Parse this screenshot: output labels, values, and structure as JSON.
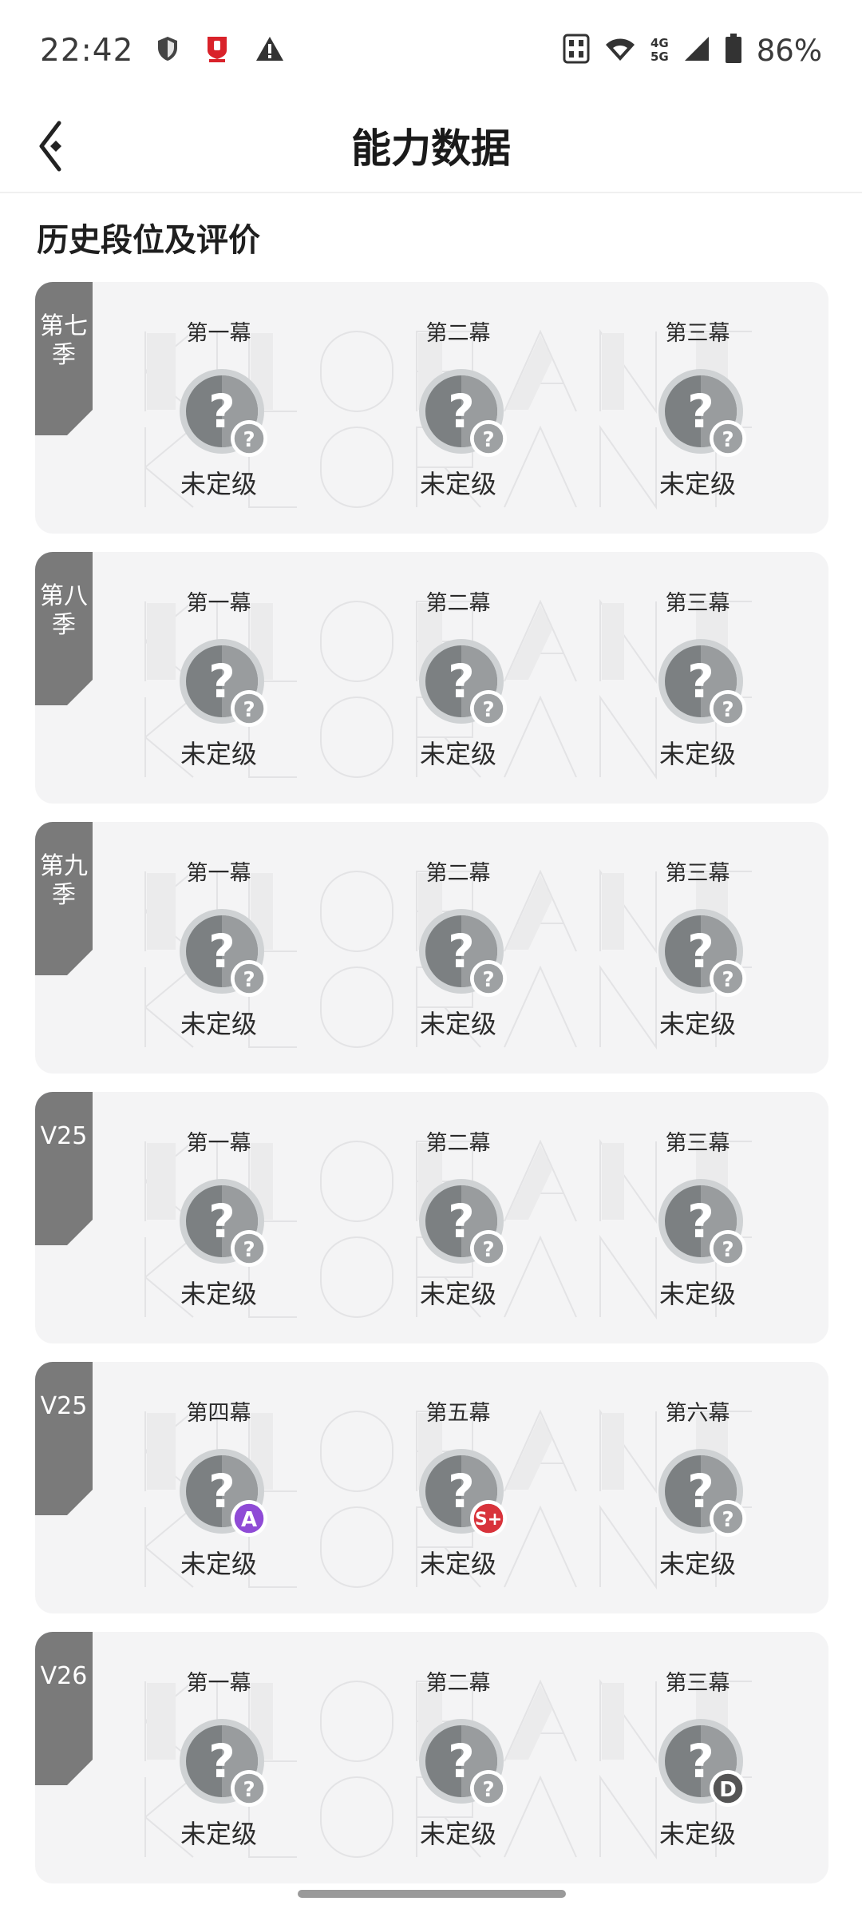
{
  "status_bar": {
    "time": "22:42",
    "battery": "86%",
    "net_top": "4G",
    "net_bottom": "5G",
    "icons": [
      "shield-icon",
      "app-notification-icon",
      "warning-icon",
      "nfc-icon",
      "wifi-icon",
      "cellular-signal-icon",
      "battery-icon"
    ]
  },
  "header": {
    "title": "能力数据",
    "back_icon": "back-arrow-icon"
  },
  "section": {
    "title": "历史段位及评价"
  },
  "colors": {
    "tab_gray": "#7a7a7a",
    "card_bg": "#f4f4f5",
    "emblem_gray": "#7c8082",
    "badge_purple": "#8f4bd6",
    "badge_red": "#d8333b",
    "badge_dark": "#555555"
  },
  "seasons": [
    {
      "label": "第七季",
      "acts": [
        {
          "name": "第一幕",
          "status": "未定级",
          "badge": "?"
        },
        {
          "name": "第二幕",
          "status": "未定级",
          "badge": "?"
        },
        {
          "name": "第三幕",
          "status": "未定级",
          "badge": "?"
        }
      ]
    },
    {
      "label": "第八季",
      "acts": [
        {
          "name": "第一幕",
          "status": "未定级",
          "badge": "?"
        },
        {
          "name": "第二幕",
          "status": "未定级",
          "badge": "?"
        },
        {
          "name": "第三幕",
          "status": "未定级",
          "badge": "?"
        }
      ]
    },
    {
      "label": "第九季",
      "acts": [
        {
          "name": "第一幕",
          "status": "未定级",
          "badge": "?"
        },
        {
          "name": "第二幕",
          "status": "未定级",
          "badge": "?"
        },
        {
          "name": "第三幕",
          "status": "未定级",
          "badge": "?"
        }
      ]
    },
    {
      "label": "V25",
      "acts": [
        {
          "name": "第一幕",
          "status": "未定级",
          "badge": "?"
        },
        {
          "name": "第二幕",
          "status": "未定级",
          "badge": "?"
        },
        {
          "name": "第三幕",
          "status": "未定级",
          "badge": "?"
        }
      ]
    },
    {
      "label": "V25",
      "acts": [
        {
          "name": "第四幕",
          "status": "未定级",
          "badge": "A"
        },
        {
          "name": "第五幕",
          "status": "未定级",
          "badge": "S+"
        },
        {
          "name": "第六幕",
          "status": "未定级",
          "badge": "?"
        }
      ]
    },
    {
      "label": "V26",
      "acts": [
        {
          "name": "第一幕",
          "status": "未定级",
          "badge": "?"
        },
        {
          "name": "第二幕",
          "status": "未定级",
          "badge": "?"
        },
        {
          "name": "第三幕",
          "status": "未定级",
          "badge": "D"
        }
      ]
    }
  ]
}
